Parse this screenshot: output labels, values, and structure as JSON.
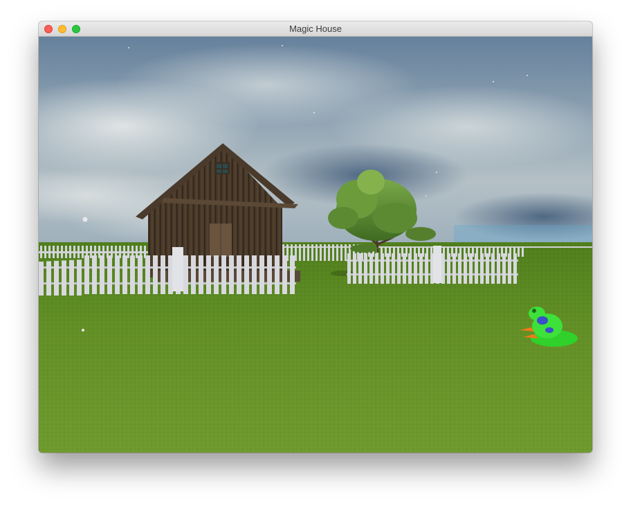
{
  "window": {
    "title": "Magic House",
    "controls": [
      "close",
      "minimize",
      "zoom"
    ]
  },
  "scene": {
    "objects": [
      "sky",
      "grass-field",
      "wooden-house",
      "white-picket-fence",
      "tree",
      "frog"
    ],
    "colors": {
      "sky_top": "#5a7a99",
      "sky_cloud": "#c9d2d6",
      "grass": "#5f8f24",
      "house_wood": "#4a3a2c",
      "fence": "#d6d6dc",
      "frog": "#2fd12a",
      "frog_spots": "#3a4fc8",
      "frog_feet": "#f07a1a"
    }
  }
}
